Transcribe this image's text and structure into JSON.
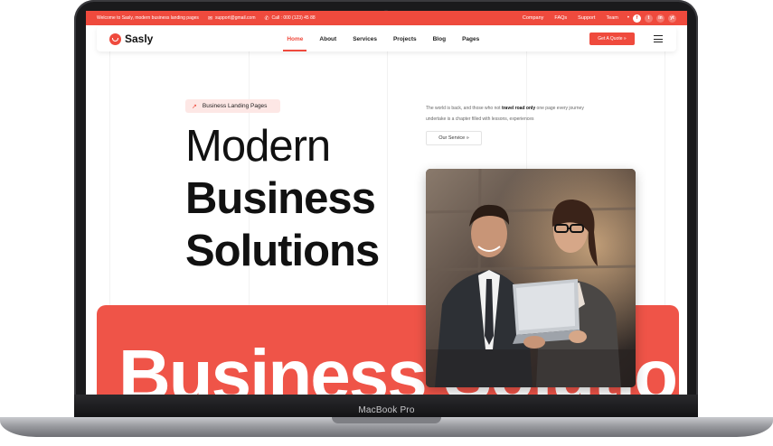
{
  "topbar": {
    "welcome": "Welcome to Sasly, modern business landing pages",
    "email": "support@gmail.com",
    "phone": "Call : 000 (123) 45 88",
    "links": [
      "Company",
      "FAQs",
      "Support",
      "Team"
    ],
    "social": [
      "f",
      "t",
      "in",
      "yt"
    ],
    "color": "#ef4a3d"
  },
  "navbar": {
    "brand": "Sasly",
    "items": [
      "Home",
      "About",
      "Services",
      "Projects",
      "Blog",
      "Pages"
    ],
    "active": "Home",
    "quote_button": "Get A Quote »"
  },
  "hero": {
    "badge": "Business Landing Pages",
    "title_line1": "Modern",
    "title_line2": "Business",
    "title_line3": "Solutions",
    "desc_before": "The world is back, and those who not ",
    "desc_bold": "travel road only",
    "desc_after": " one page every journey undertake is a chapter filled with lessons, experiences",
    "service_button": "Our Service »"
  },
  "band": {
    "text": "Business Solution",
    "color": "#ef5448"
  },
  "device": {
    "label": "MacBook Pro"
  }
}
